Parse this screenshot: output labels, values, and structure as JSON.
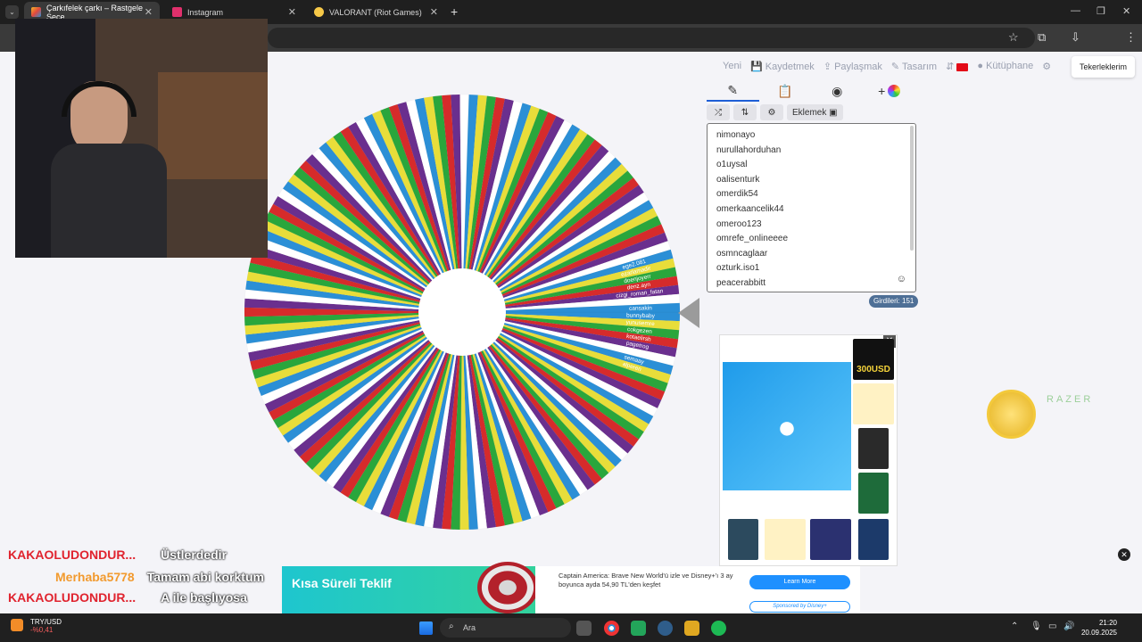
{
  "browser": {
    "tabs": [
      {
        "title": "Çarkıfelek çarkı – Rastgele Seçe",
        "active": true,
        "favicon_color": "#f2b62a"
      },
      {
        "title": "Instagram",
        "active": false,
        "favicon_color": "#e1306c"
      },
      {
        "title": "VALORANT (Riot Games)",
        "active": false,
        "favicon_color": "#f7c948"
      }
    ]
  },
  "site": {
    "nav": {
      "new": "Yeni",
      "save": "Kaydetmek",
      "share": "Paylaşmak",
      "design": "Tasarım",
      "library": "Kütüphane",
      "wheels_button": "Tekerleklerim"
    },
    "panel": {
      "add_button": "Eklemek",
      "entries": [
        "nimonayo",
        "nurullahorduhan",
        "o1uysal",
        "oalisenturk",
        "omerdik54",
        "omerkaancelik44",
        "omeroo123",
        "omrefe_onlineeee",
        "osmncaglaar",
        "ozturk.iso1",
        "peacerabbitt"
      ],
      "entry_count_label": "Girdileri: 151"
    },
    "wheel": {
      "segment_count": 151,
      "colors": [
        "#2b8fd6",
        "#e8dd3a",
        "#2aa63c",
        "#d62b2b",
        "#6a2f8e",
        "#ffffff"
      ],
      "visible_labels": [
        "ege2.081",
        "ezarlamadir",
        "doenjoyerr",
        "denz.ayn",
        "cizgi_roman_fatan",
        "yasinserbecha",
        "cansakin",
        "bunnybaby",
        "yunusemre",
        "cokgezen",
        "kotaelirsh",
        "pagetrog",
        "kayyumm",
        "semaay",
        "alperen"
      ]
    },
    "ad": {
      "thumb_label": "300USD"
    },
    "razer_text": "RAZER"
  },
  "chat": [
    {
      "user": "KAKAOLUDONDUR...",
      "message": "Üstlerdedir"
    },
    {
      "user": "Merhaba5778",
      "message": "Tamam abi korktum"
    },
    {
      "user": "KAKAOLUDONDUR...",
      "message": "A ile başlıyosa"
    }
  ],
  "banner": {
    "title": "Kısa Süreli Teklif",
    "text": "Captain America: Brave New World'ü izle ve Disney+'ı 3 ay boyunca ayda 54,90 TL'den keşfet",
    "learn_more": "Learn More",
    "sponsored": "Sponsored by Disney+"
  },
  "taskbar": {
    "ticker_pair": "TRY/USD",
    "ticker_change": "-%0,41",
    "search_placeholder": "Ara",
    "time": "21:20",
    "date": "20.09.2025"
  }
}
